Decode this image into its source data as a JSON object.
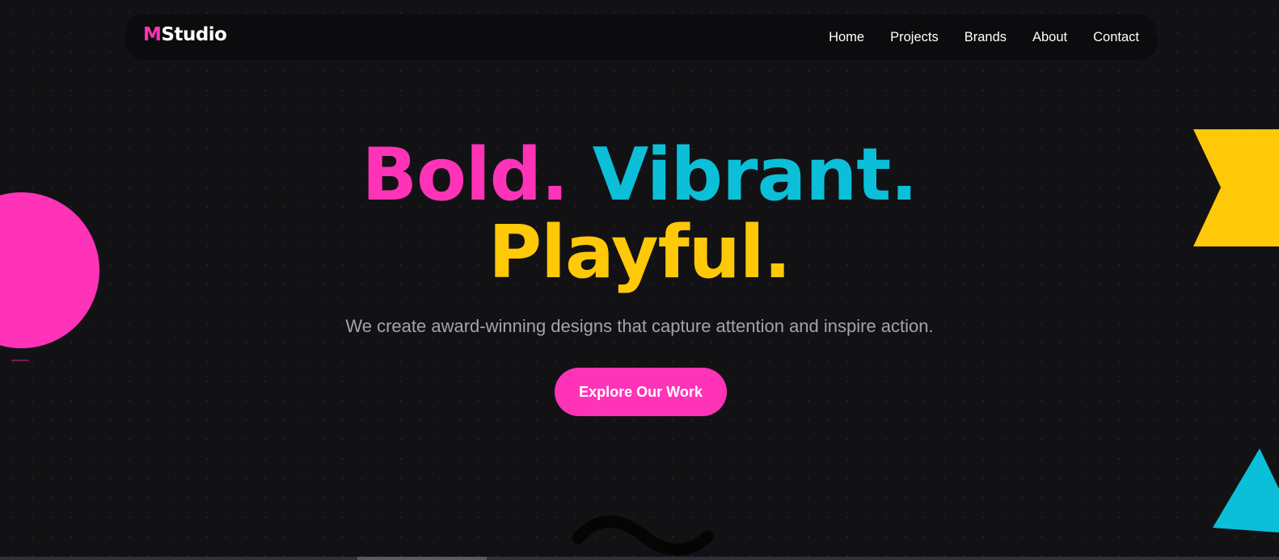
{
  "nav": {
    "logo_accent": "M",
    "logo_rest": "Studio",
    "links": [
      "Home",
      "Projects",
      "Brands",
      "About",
      "Contact"
    ]
  },
  "hero": {
    "word1": "Bold.",
    "word2": "Vibrant.",
    "word3": "Playful.",
    "subtitle": "We create award-winning designs that capture attention and inspire action.",
    "cta_label": "Explore Our Work"
  },
  "colors": {
    "background": "#121215",
    "pink": "#ff33b8",
    "cyan": "#0bbfd9",
    "yellow": "#ffc808",
    "subtitle_gray": "#a3a3ad"
  },
  "decor": {
    "shapes": [
      "pink-circle",
      "yellow-ribbon",
      "cyan-triangle",
      "black-squiggle"
    ]
  }
}
